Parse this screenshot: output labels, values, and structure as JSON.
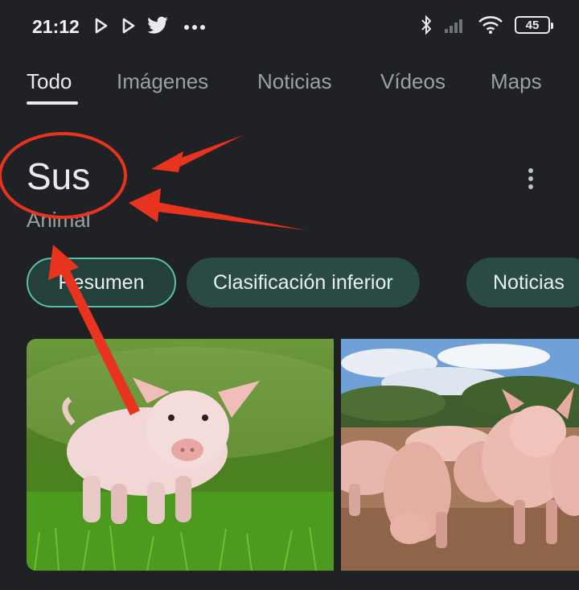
{
  "status_bar": {
    "time": "21:12",
    "battery": "45",
    "left_icons": [
      "play-icon",
      "play-icon",
      "twitter-icon",
      "more-dots-icon"
    ],
    "right_icons": [
      "bluetooth-icon",
      "signal-icon",
      "wifi-icon",
      "battery-icon"
    ]
  },
  "tabs": [
    {
      "label": "Todo",
      "active": true
    },
    {
      "label": "Imágenes"
    },
    {
      "label": "Noticias"
    },
    {
      "label": "Vídeos"
    },
    {
      "label": "Maps"
    }
  ],
  "entity": {
    "title": "Sus",
    "subtitle": "Animal"
  },
  "chips": [
    {
      "label": "Resumen",
      "selected": true
    },
    {
      "label": "Clasificación inferior"
    },
    {
      "label": "Noticias"
    }
  ],
  "images": [
    {
      "subject": "piglet on grass"
    },
    {
      "subject": "pigs in a dirt field"
    }
  ],
  "colors": {
    "background": "#202124",
    "chip": "#2a4a44",
    "chip_selected_border": "#5bbfa8",
    "annotation": "#e8331f"
  }
}
